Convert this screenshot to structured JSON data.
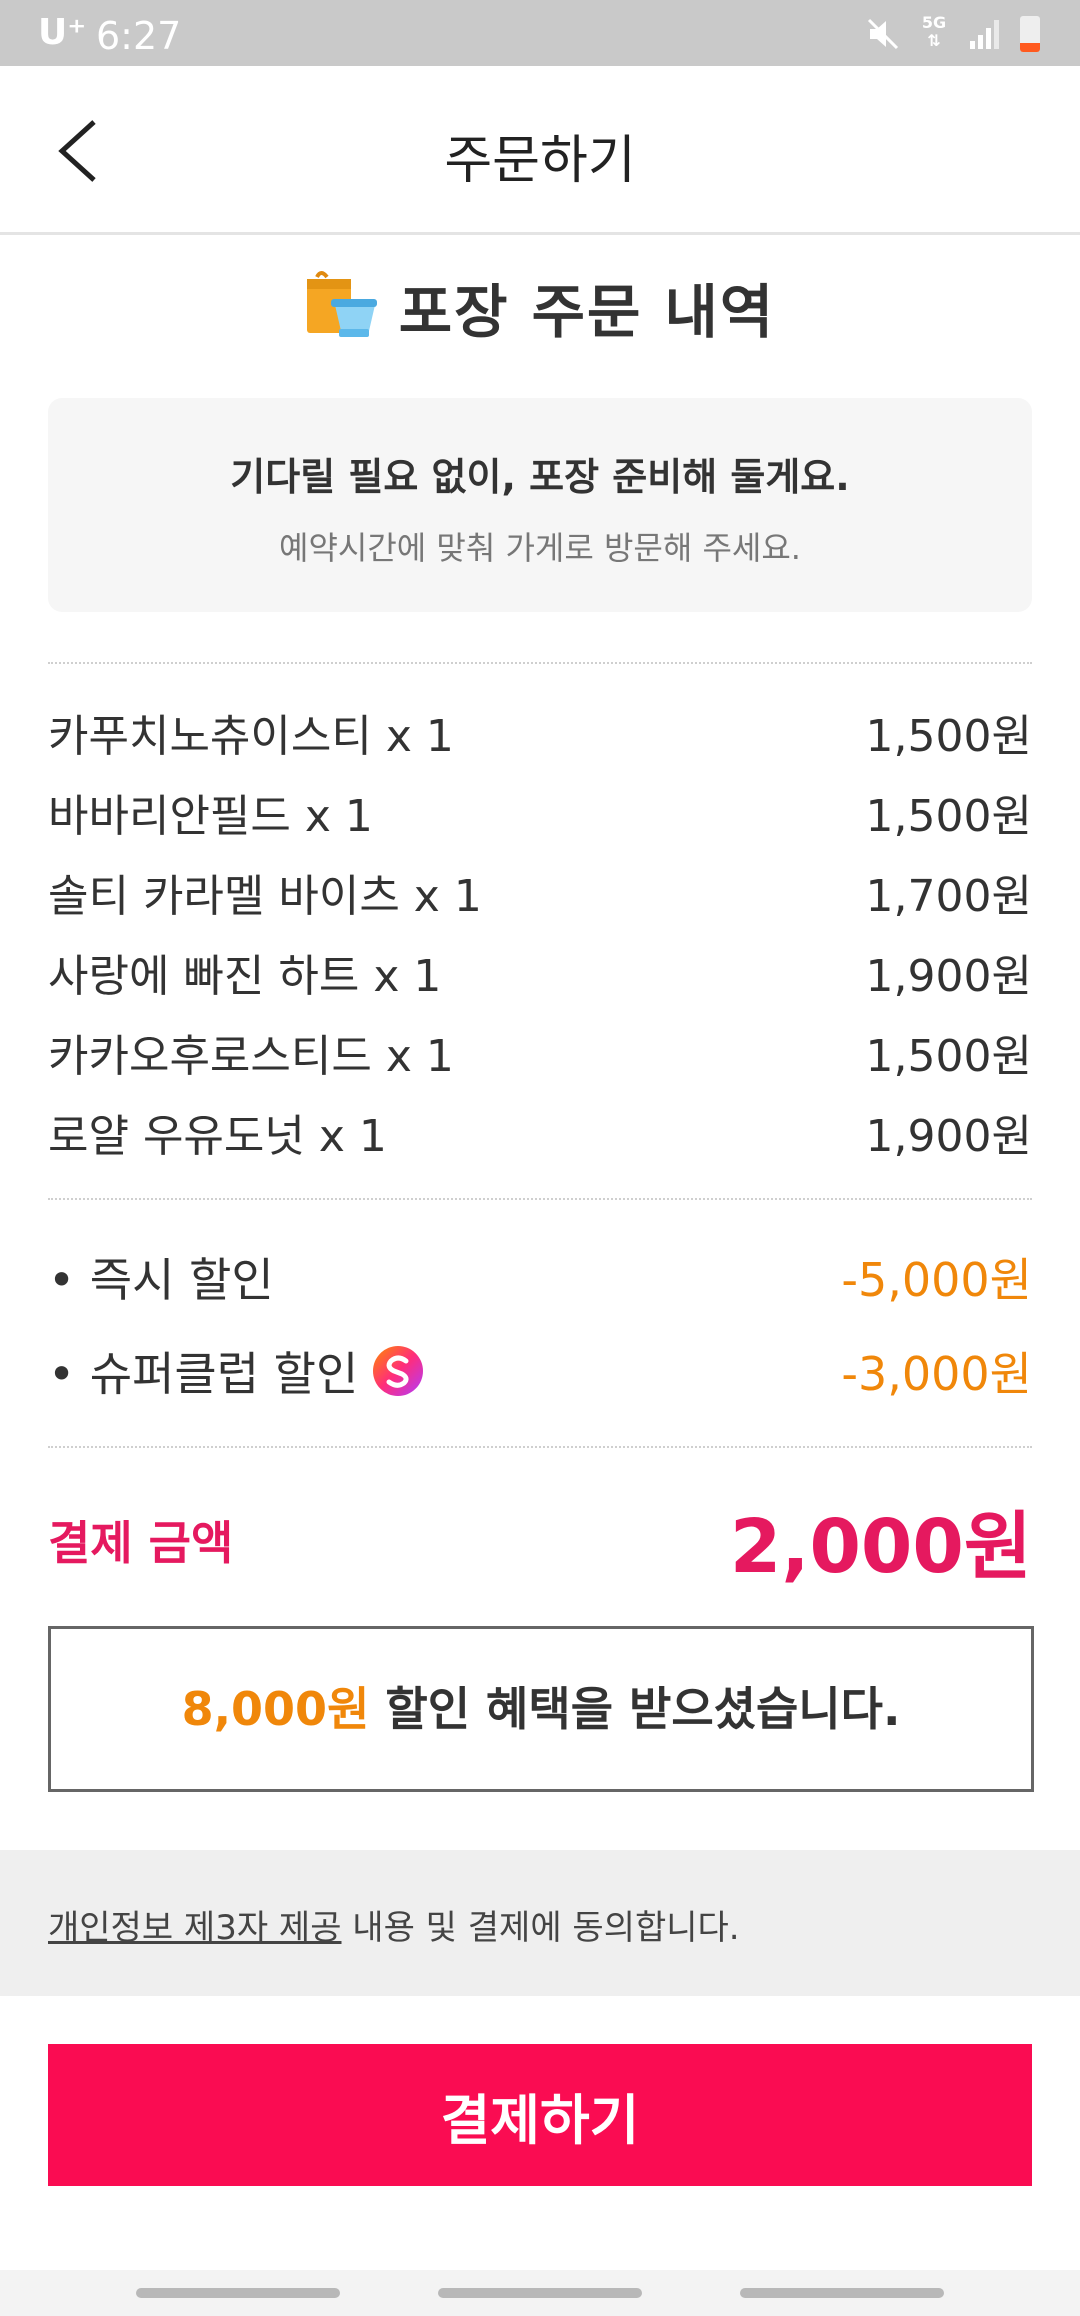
{
  "status_bar": {
    "carrier": "U⁺",
    "time": "6:27",
    "network": "5G",
    "icons": [
      "mute-icon",
      "5g-icon",
      "signal-icon",
      "battery-low-icon"
    ]
  },
  "header": {
    "title": "주문하기",
    "back_icon": "chevron-left-icon"
  },
  "section": {
    "title": "포장 주문 내역",
    "icon": "takeout-bag-icon"
  },
  "notice": {
    "main": "기다릴 필요 없이, 포장 준비해 둘게요.",
    "sub": "예약시간에 맞춰 가게로 방문해 주세요."
  },
  "items": [
    {
      "name": "카푸치노츄이스티 x 1",
      "price": "1,500원"
    },
    {
      "name": "바바리안필드 x 1",
      "price": "1,500원"
    },
    {
      "name": "솔티 카라멜 바이츠 x 1",
      "price": "1,700원"
    },
    {
      "name": "사랑에 빠진 하트 x 1",
      "price": "1,900원"
    },
    {
      "name": "카카오후로스티드 x 1",
      "price": "1,500원"
    },
    {
      "name": "로얄 우유도넛 x 1",
      "price": "1,900원"
    }
  ],
  "discounts": [
    {
      "label": "• 즉시 할인",
      "amount": "-5,000원"
    },
    {
      "label": "• 슈퍼클럽 할인",
      "amount": "-3,000원",
      "badge_icon": "super-club-badge-icon"
    }
  ],
  "total": {
    "label": "결제 금액",
    "amount": "2,000원"
  },
  "benefit": {
    "amount": "8,000원",
    "text": " 할인 혜택을 받으셨습니다."
  },
  "consent": {
    "link": "개인정보 제3자 제공",
    "text": " 내용 및 결제에 동의합니다."
  },
  "pay_button": {
    "label": "결제하기"
  },
  "colors": {
    "accent": "#fa0c52",
    "total": "#e5195f",
    "discount": "#f0870a"
  }
}
